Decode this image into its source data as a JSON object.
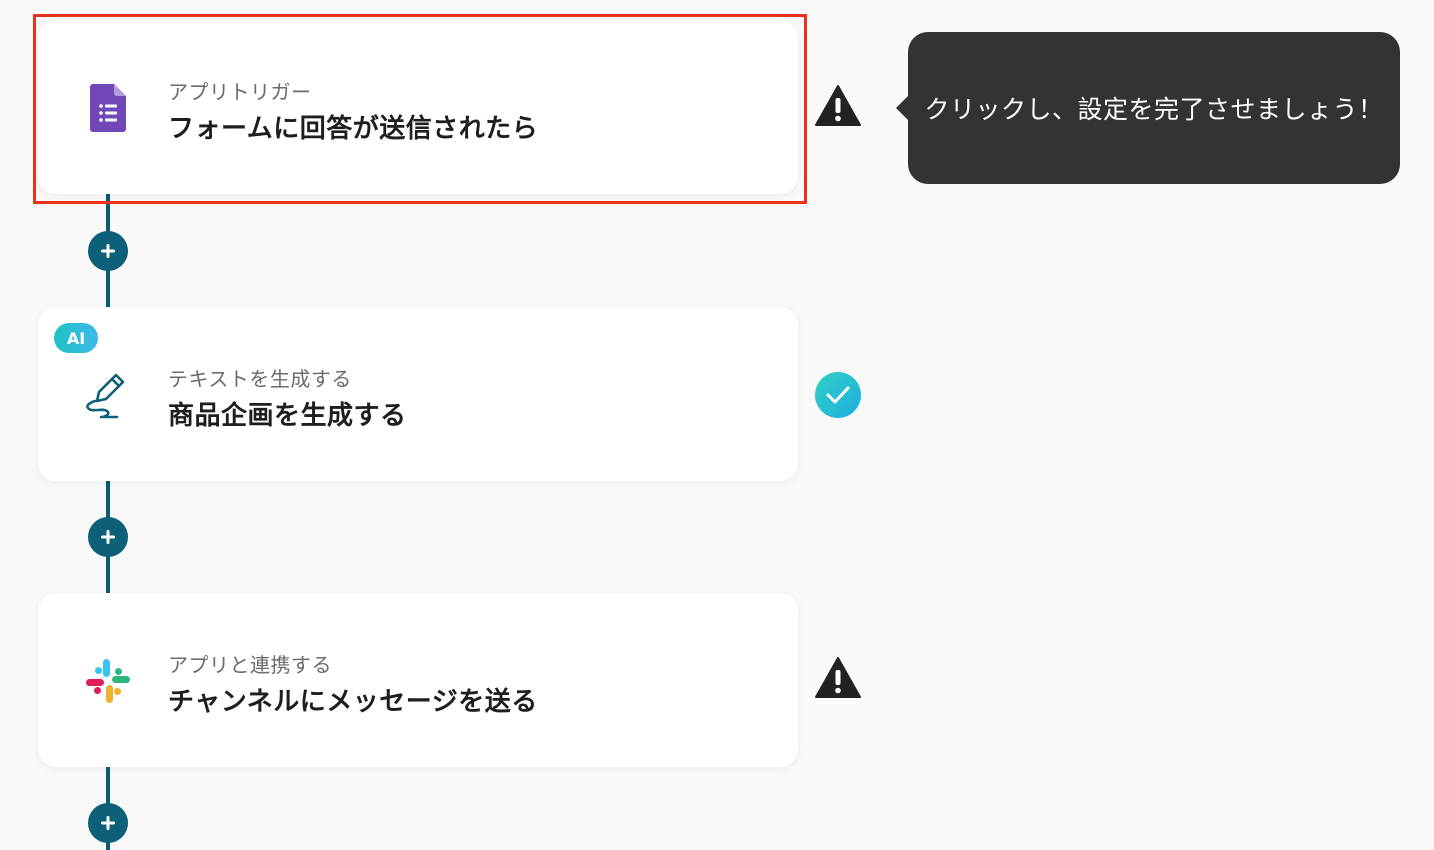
{
  "steps": [
    {
      "subtitle": "アプリトリガー",
      "title": "フォームに回答が送信されたら",
      "icon": "google-forms-icon",
      "status": "warning"
    },
    {
      "badge": "AI",
      "subtitle": "テキストを生成する",
      "title": "商品企画を生成する",
      "icon": "pen-write-icon",
      "status": "complete"
    },
    {
      "subtitle": "アプリと連携する",
      "title": "チャンネルにメッセージを送る",
      "icon": "slack-icon",
      "status": "warning"
    }
  ],
  "tooltip": {
    "text": "クリックし、設定を完了させましょう！"
  },
  "colors": {
    "connector": "#0b5b73",
    "add_button": "#0e5f78",
    "highlight": "#e8321e",
    "tooltip_bg": "#333333",
    "check": "#24c2d6",
    "forms_purple": "#7248b9"
  }
}
